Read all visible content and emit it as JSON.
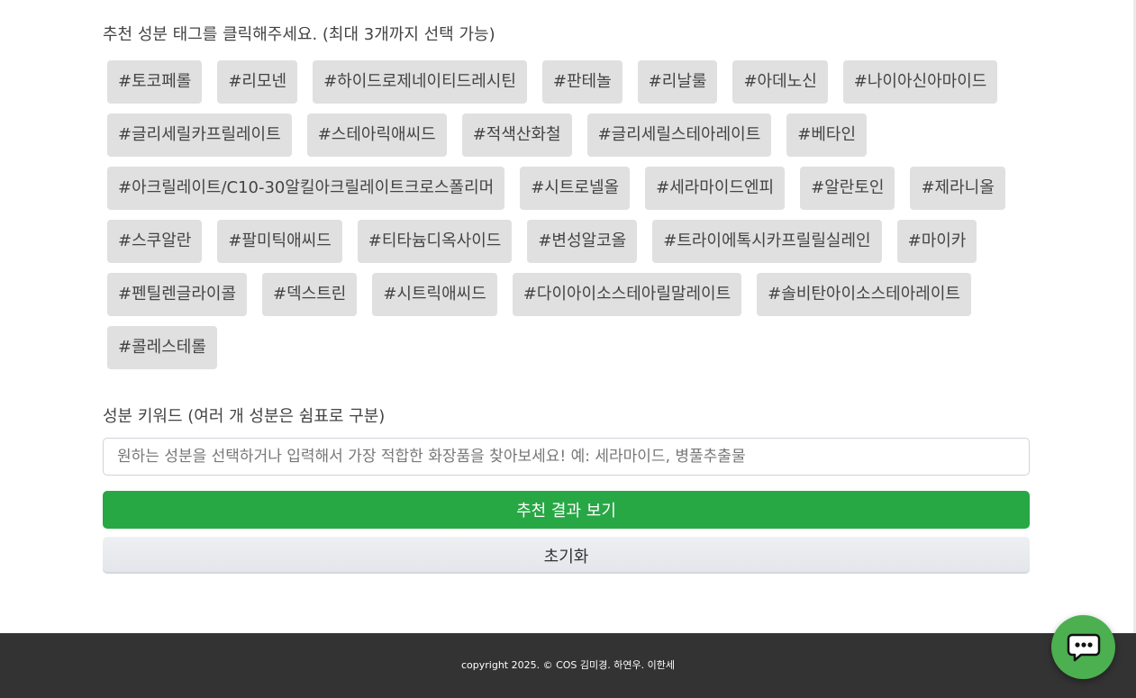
{
  "instruction": "추천 성분 태그를 클릭해주세요. (최대 3개까지 선택 가능)",
  "tags": [
    "#토코페롤",
    "#리모넨",
    "#하이드로제네이티드레시틴",
    "#판테놀",
    "#리날룰",
    "#아데노신",
    "#나이아신아마이드",
    "#글리세릴카프릴레이트",
    "#스테아릭애씨드",
    "#적색산화철",
    "#글리세릴스테아레이트",
    "#베타인",
    "#아크릴레이트/C10-30알킬아크릴레이트크로스폴리머",
    "#시트로넬올",
    "#세라마이드엔피",
    "#알란토인",
    "#제라니올",
    "#스쿠알란",
    "#팔미틱애씨드",
    "#티타늄디옥사이드",
    "#변성알코올",
    "#트라이에톡시카프릴릴실레인",
    "#마이카",
    "#펜틸렌글라이콜",
    "#덱스트린",
    "#시트릭애씨드",
    "#다이아이소스테아릴말레이트",
    "#솔비탄아이소스테아레이트",
    "#콜레스테롤"
  ],
  "keyword": {
    "label": "성분 키워드 (여러 개 성분은 쉼표로 구분)",
    "placeholder": "원하는 성분을 선택하거나 입력해서 가장 적합한 화장품을 찾아보세요! 예: 세라마이드, 병풀추출물",
    "value": ""
  },
  "buttons": {
    "submit": "추천 결과 보기",
    "reset": "초기화"
  },
  "footer": {
    "copyright": "copyright 2025. © COS 김미경. 하연우. 이한세"
  },
  "chat": {
    "icon": "chat-bubble-icon"
  },
  "colors": {
    "accent": "#28a745",
    "tag_bg": "#e0e0e0",
    "footer_bg": "#333333",
    "chat_bg": "#4caf50"
  }
}
